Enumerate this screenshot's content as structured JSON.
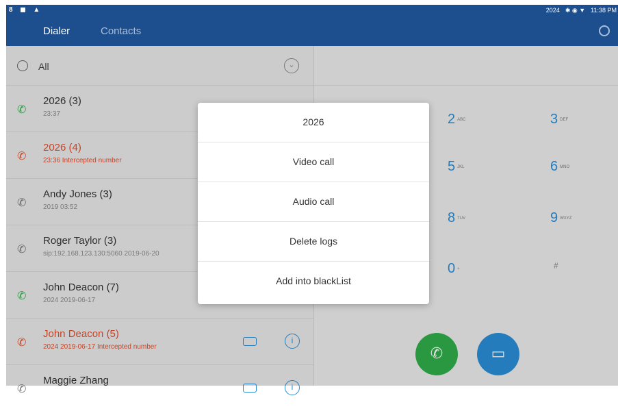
{
  "status_bar": {
    "left_icons": "8 ◼ ▲",
    "right_text": "2024",
    "right_icons": "✱ ◉ ▼",
    "time": "11:38 PM"
  },
  "header": {
    "tabs": [
      {
        "label": "Dialer",
        "active": true
      },
      {
        "label": "Contacts",
        "active": false
      }
    ],
    "settings_icon": "gear-icon"
  },
  "call_log": {
    "filter_label": "All",
    "entries": [
      {
        "name": "2026 (3)",
        "sub": "23:37",
        "type": "incoming"
      },
      {
        "name": "2026 (4)",
        "sub": "23:36 Intercepted number",
        "type": "missed"
      },
      {
        "name": "Andy Jones (3)",
        "sub": "2019 03:52",
        "type": "outgoing"
      },
      {
        "name": "Roger Taylor (3)",
        "sub": "sip:192.168.123.130:5060 2019-06-20",
        "type": "outgoing"
      },
      {
        "name": "John Deacon (7)",
        "sub": "2024 2019-06-17",
        "type": "incoming"
      },
      {
        "name": "John Deacon (5)",
        "sub": "2024 2019-06-17 Intercepted number",
        "type": "missed"
      },
      {
        "name": "Maggie Zhang",
        "sub": "",
        "type": "outgoing"
      }
    ]
  },
  "dialpad": {
    "keys": [
      {
        "digit": "2",
        "letters": "ABC"
      },
      {
        "digit": "3",
        "letters": "DEF"
      },
      {
        "digit": "5",
        "letters": "JKL"
      },
      {
        "digit": "6",
        "letters": "MNO"
      },
      {
        "digit": "8",
        "letters": "TUV"
      },
      {
        "digit": "9",
        "letters": "WXYZ"
      },
      {
        "digit": "0",
        "letters": "+"
      },
      {
        "digit": "#",
        "letters": ""
      }
    ]
  },
  "context_menu": {
    "title": "2026",
    "items": [
      "Video call",
      "Audio call",
      "Delete logs",
      "Add into blackList"
    ]
  },
  "colors": {
    "header": "#1d4f8f",
    "accent": "#2a8ed6",
    "missed": "#e04e2e",
    "incoming": "#2fae4b"
  }
}
